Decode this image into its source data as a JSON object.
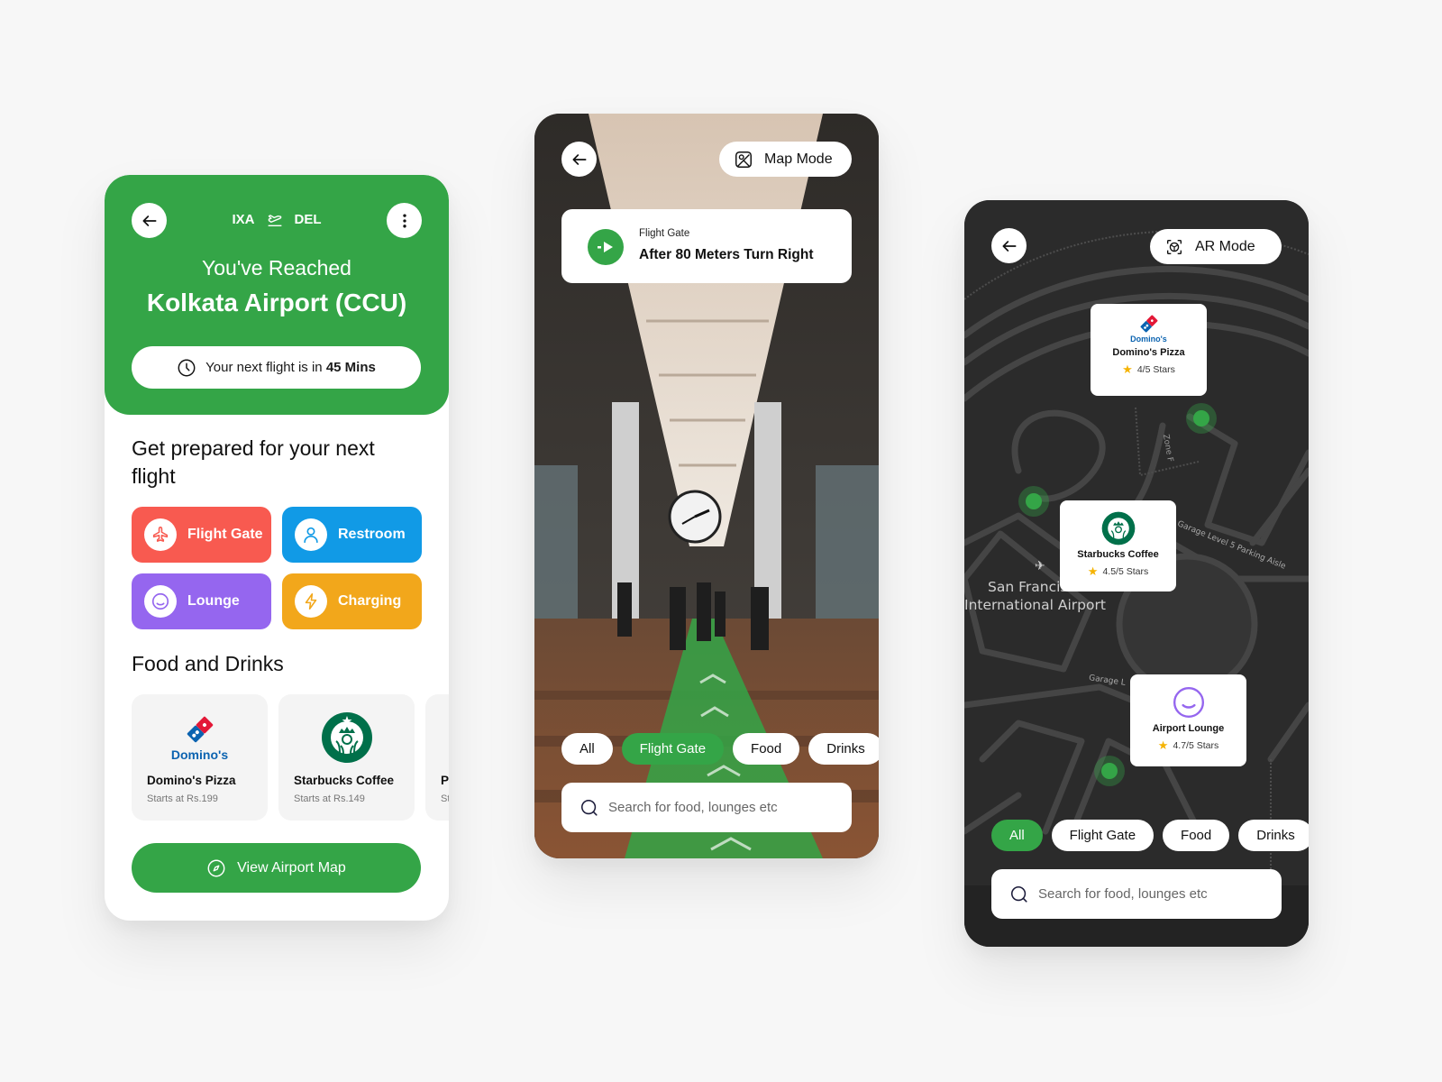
{
  "phone1": {
    "route": {
      "from": "IXA",
      "to": "DEL",
      "icon": "flight-takeoff-icon"
    },
    "greeting": "You've Reached",
    "airport_name": "Kolkata Airport (CCU)",
    "next_flight": {
      "prefix": "Your next flight is in ",
      "value": "45 Mins"
    },
    "prepare_title_line1": "Get prepared for your next",
    "prepare_title_line2": "flight",
    "quick_actions": [
      {
        "label": "Flight Gate",
        "icon": "airplane-icon",
        "color": "#f85a50"
      },
      {
        "label": "Restroom",
        "icon": "person-icon",
        "color": "#119ae6"
      },
      {
        "label": "Lounge",
        "icon": "smile-icon",
        "color": "#9566ef"
      },
      {
        "label": "Charging",
        "icon": "lightning-icon",
        "color": "#f2a71b"
      }
    ],
    "food_title": "Food and Drinks",
    "food_items": [
      {
        "name": "Domino's Pizza",
        "price": "Starts at Rs.199",
        "logo_text": "Domino's"
      },
      {
        "name": "Starbucks Coffee",
        "price": "Starts at Rs.149"
      },
      {
        "name": "Pi",
        "price": "St"
      }
    ],
    "view_map_label": "View Airport Map"
  },
  "phone2": {
    "mode_button": "Map Mode",
    "nav": {
      "label": "Flight Gate",
      "instruction": "After 80 Meters Turn Right"
    },
    "chips": [
      {
        "label": "All",
        "active": false
      },
      {
        "label": "Flight Gate",
        "active": true
      },
      {
        "label": "Food",
        "active": false
      },
      {
        "label": "Drinks",
        "active": false
      }
    ],
    "search_placeholder": "Search for food, lounges etc"
  },
  "phone3": {
    "mode_button": "AR Mode",
    "pois": [
      {
        "name": "Domino's Pizza",
        "rating": "4/5 Stars",
        "logo_text": "Domino's"
      },
      {
        "name": "Starbucks Coffee",
        "rating": "4.5/5 Stars"
      },
      {
        "name": "Airport Lounge",
        "rating": "4.7/5 Stars"
      }
    ],
    "map_labels": {
      "airport_line1": "San Francisco",
      "airport_line2": "International Airport",
      "zone_f": "Zone F",
      "zone_f_road": "Zone F/G",
      "garage_level": "Garage Level 5 Parking Aisle",
      "garage_short": "Garage L"
    },
    "chips": [
      {
        "label": "All",
        "active": true
      },
      {
        "label": "Flight Gate",
        "active": false
      },
      {
        "label": "Food",
        "active": false
      },
      {
        "label": "Drinks",
        "active": false
      }
    ],
    "search_placeholder": "Search for food, lounges etc"
  },
  "colors": {
    "brand_green": "#34a547",
    "flight_gate": "#f85a50",
    "restroom": "#119ae6",
    "lounge": "#9566ef",
    "charging": "#f2a71b",
    "map_bg": "#2b2b2b",
    "star": "#f5b301"
  }
}
